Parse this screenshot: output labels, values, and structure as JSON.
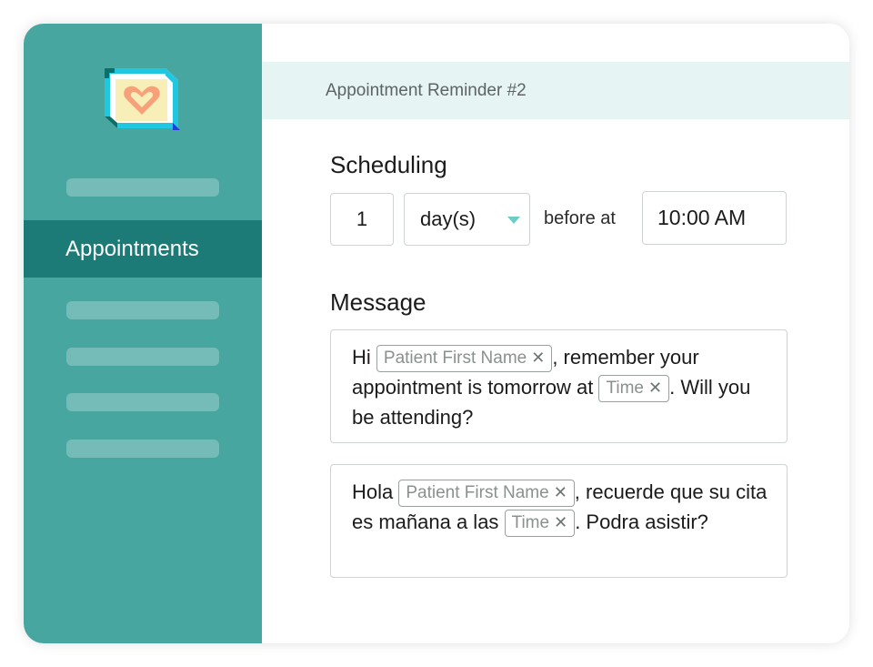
{
  "sidebar": {
    "active_item": "Appointments",
    "accent_color": "#48a6a1",
    "active_color": "#1c7a77"
  },
  "header": {
    "title": "Appointment Reminder #2"
  },
  "scheduling": {
    "title": "Scheduling",
    "amount": "1",
    "unit": "day(s)",
    "before_label": "before at",
    "time": "10:00 AM"
  },
  "message": {
    "title": "Message",
    "english": {
      "greeting": "Hi",
      "name_tag": "Patient First Name",
      "middle": ", remember your appointment is tomorrow at",
      "time_tag": "Time",
      "end": ". Will you be attending?"
    },
    "spanish": {
      "greeting": "Hola",
      "name_tag": "Patient First Name",
      "middle": ", recuerde que su cita es mañana a las",
      "time_tag": "Time",
      "end": ". Podra asistir?"
    },
    "tag_remove_glyph": "✕"
  }
}
